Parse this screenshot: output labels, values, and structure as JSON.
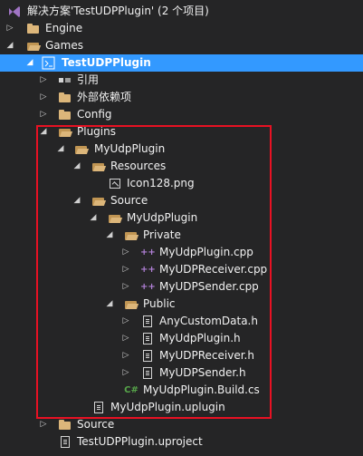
{
  "solution": {
    "label": "解决方案'TestUDPPlugin' (2 个项目)"
  },
  "tree": {
    "engine": "Engine",
    "games": "Games",
    "project": "TestUDPPlugin",
    "references": "引用",
    "external_deps": "外部依赖项",
    "config": "Config",
    "plugins": "Plugins",
    "myudpplugin": "MyUdpPlugin",
    "resources": "Resources",
    "icon": "Icon128.png",
    "source": "Source",
    "src_myudpplugin": "MyUdpPlugin",
    "private": "Private",
    "cpp1": "MyUdpPlugin.cpp",
    "cpp2": "MyUDPReceiver.cpp",
    "cpp3": "MyUDPSender.cpp",
    "public": "Public",
    "h1": "AnyCustomData.h",
    "h2": "MyUdpPlugin.h",
    "h3": "MyUDPReceiver.h",
    "h4": "MyUDPSender.h",
    "buildcs": "MyUdpPlugin.Build.cs",
    "uplugin": "MyUdpPlugin.uplugin",
    "source2": "Source",
    "uproject": "TestUDPPlugin.uproject"
  },
  "icons": {
    "cpp_glyph": "++",
    "cs_glyph": "C#",
    "collapsed_glyph": "▷",
    "expanded_glyph": "◢"
  },
  "colors": {
    "selection": "#3399ff",
    "highlight_border": "#e81123",
    "folder": "#dcb67a",
    "background": "#252526"
  }
}
